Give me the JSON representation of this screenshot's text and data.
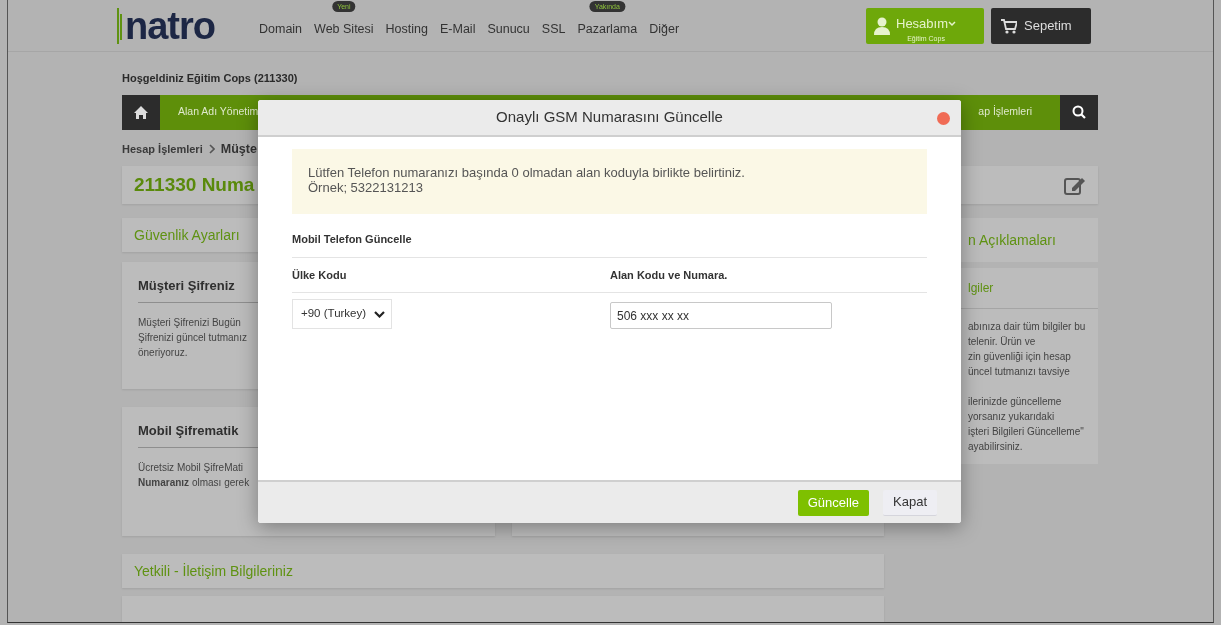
{
  "header": {
    "logo": "natro",
    "nav": [
      {
        "label": "Domain"
      },
      {
        "label": "Web Sitesi",
        "badge": "Yeni"
      },
      {
        "label": "Hosting"
      },
      {
        "label": "E-Mail"
      },
      {
        "label": "Sunucu"
      },
      {
        "label": "SSL"
      },
      {
        "label": "Pazarlama",
        "badge": "Yakında"
      },
      {
        "label": "Diğer"
      }
    ],
    "account": {
      "label": "Hesabım",
      "sub": "Eğitim Cops"
    },
    "cart": "Sepetim"
  },
  "welcome": "Hoşgeldiniz Eğitim Cops (211330)",
  "menu_bar": {
    "items": [
      "Alan Adı Yönetim",
      "ap İşlemleri"
    ]
  },
  "breadcrumb": [
    "Hesap İşlemleri",
    "Müşte"
  ],
  "page_title": "211330 Numa",
  "section_title": "Güvenlik Ayarları",
  "cards": [
    {
      "title": "Müşteri Şifreniz",
      "lines": [
        "Müşteri Şifrenizi Bugün",
        "Şifrenizi güncel tutmanız",
        "öneriyoruz."
      ]
    },
    {
      "title": "Mobil Şifrematik",
      "lines": [
        "Ücretsiz Mobil ŞifreMati",
        "**Numaranız** olması gerek"
      ]
    }
  ],
  "bottom_section_title": "Yetkili - İletişim Bilgileriniz",
  "sidebar": {
    "title": "n Açıklamaları",
    "subtitle": "lgiler",
    "paragraphs": [
      [
        "abınıza dair tüm bilgiler bu",
        "telenir. Ürün ve",
        "zin güvenliği için hesap",
        "üncel tutmanızı tavsiye"
      ],
      [
        "ilerinizde güncelleme",
        "yorsanız yukarıdaki",
        "işteri Bilgileri Güncelleme\"",
        "ayabilirsiniz."
      ]
    ]
  },
  "modal": {
    "title": "Onaylı GSM Numarasını Güncelle",
    "alert_lines": [
      "Lütfen Telefon numaranızı başında 0 olmadan alan koduyla birlikte belirtiniz.",
      "Örnek; 5322131213"
    ],
    "section": "Mobil Telefon Güncelle",
    "country_label": "Ülke Kodu",
    "number_label": "Alan Kodu ve Numara.",
    "country_select": {
      "value": "+90 (Turkey)"
    },
    "number_input": {
      "value": "506 xxx xx xx"
    },
    "buttons": [
      {
        "label": "Güncelle",
        "kind": "primary"
      },
      {
        "label": "Kapat",
        "kind": "secondary"
      }
    ]
  }
}
